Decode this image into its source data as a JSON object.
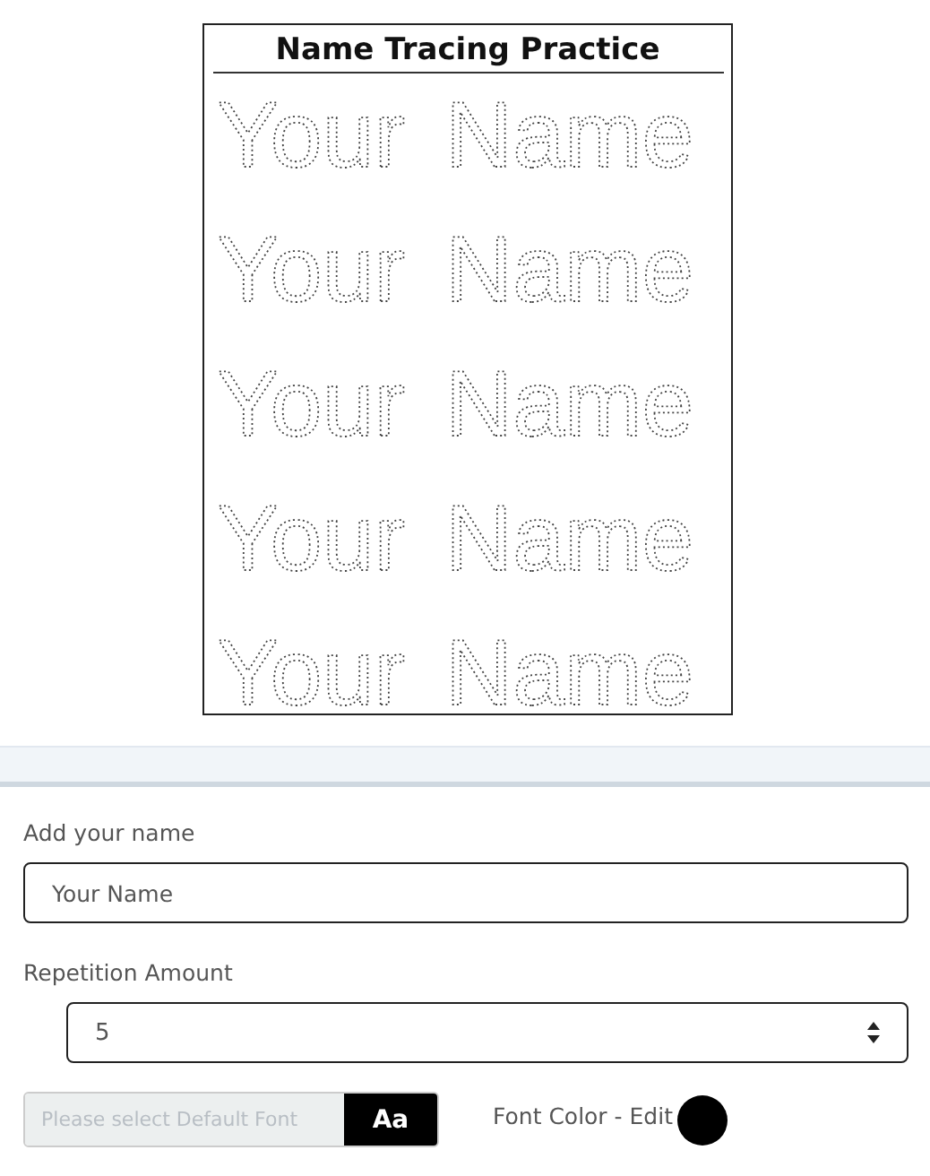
{
  "worksheet": {
    "title": "Name Tracing Practice",
    "rows": [
      "Your Name",
      "Your Name",
      "Your Name",
      "Your Name",
      "Your Name"
    ]
  },
  "form": {
    "name_label": "Add your name",
    "name_placeholder": "Your Name",
    "repetition_label": "Repetition Amount",
    "repetition_value": "5",
    "font_placeholder": "Please select Default Font",
    "font_button": "Aa",
    "font_color_label": "Font Color - Edit"
  }
}
